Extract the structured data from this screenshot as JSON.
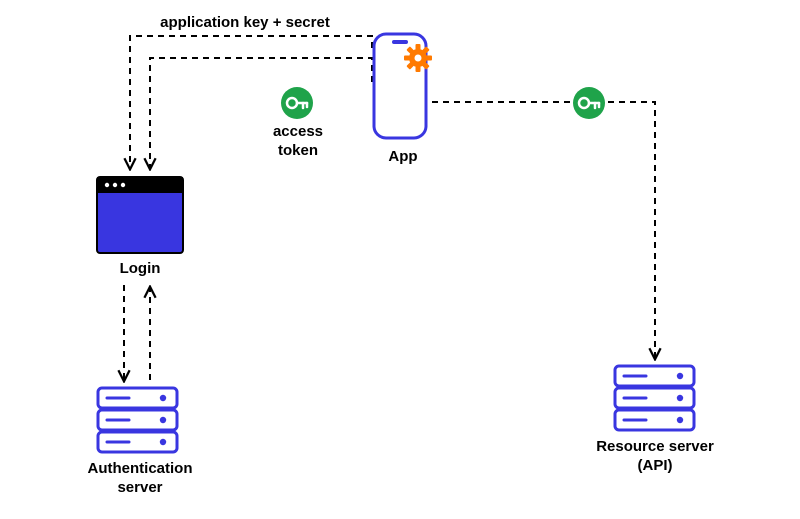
{
  "labels": {
    "app_key_secret": "application key + secret",
    "access_token": "access\ntoken",
    "app": "App",
    "login": "Login",
    "auth_server": "Authentication\nserver",
    "resource_server": "Resource server\n(API)"
  },
  "colors": {
    "stroke_primary": "#3936e0",
    "fill_browser_body": "#3936e0",
    "fill_browser_bar": "#000000",
    "key_badge_fill": "#1fa34a",
    "gear_fill": "#ff7a00",
    "dash": "#000000"
  }
}
